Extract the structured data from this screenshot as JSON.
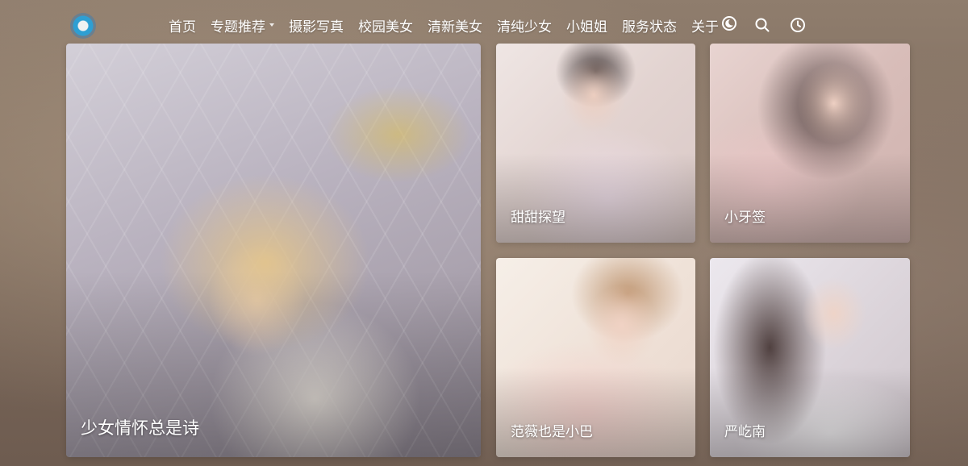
{
  "nav": {
    "items": [
      {
        "label": "首页"
      },
      {
        "label": "专题推荐"
      },
      {
        "label": "摄影写真"
      },
      {
        "label": "校园美女"
      },
      {
        "label": "清新美女"
      },
      {
        "label": "清纯少女"
      },
      {
        "label": "小姐姐"
      },
      {
        "label": "服务状态"
      },
      {
        "label": "关于"
      }
    ],
    "icons": {
      "theme": "moon-icon",
      "search": "search-icon",
      "history": "clock-icon"
    }
  },
  "colors": {
    "logo_ring": "#2e9fd3",
    "nav_text": "#ffffff"
  },
  "cards": [
    {
      "caption": "少女情怀总是诗"
    },
    {
      "caption": "甜甜探望"
    },
    {
      "caption": "小牙签"
    },
    {
      "caption": "范薇也是小巴"
    },
    {
      "caption": "严屹南"
    }
  ]
}
